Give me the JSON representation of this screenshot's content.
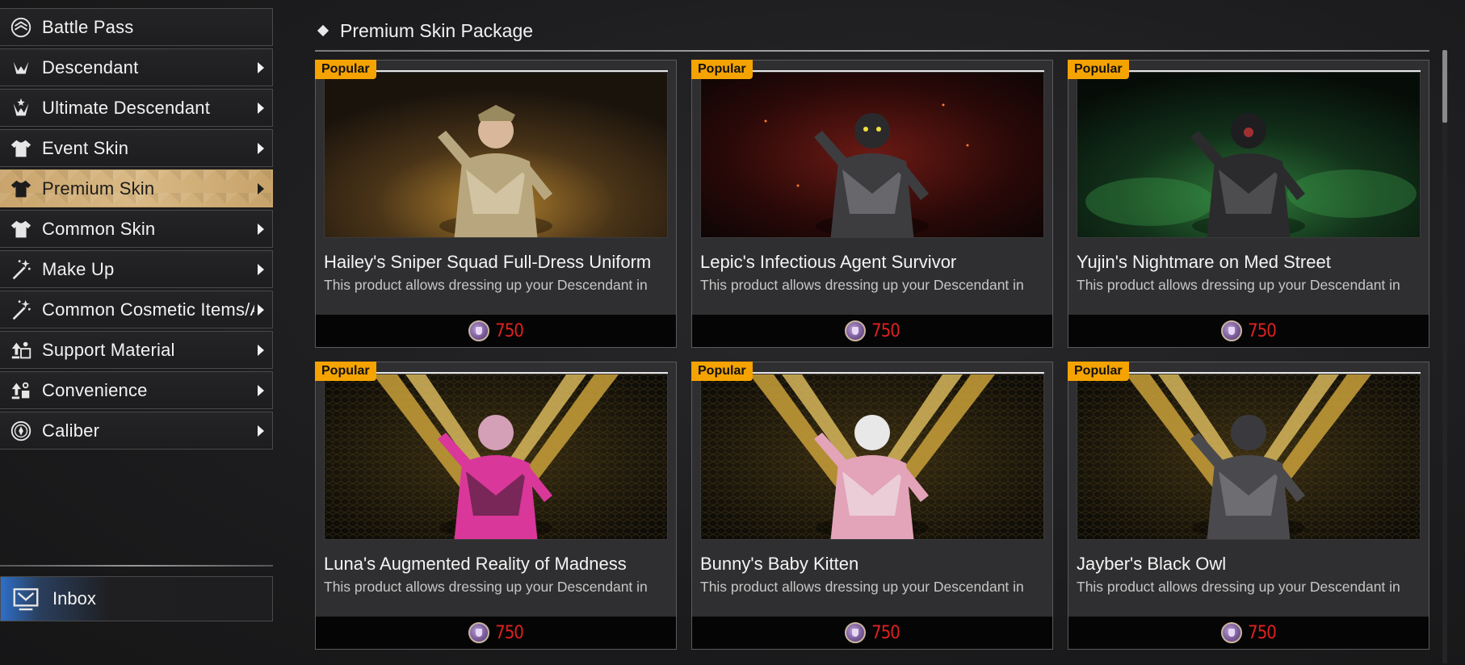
{
  "sidebar": {
    "items": [
      {
        "label": "Battle Pass",
        "icon": "battle-pass-icon",
        "has_arrow": false,
        "active": false
      },
      {
        "label": "Descendant",
        "icon": "descendant-icon",
        "has_arrow": true,
        "active": false
      },
      {
        "label": "Ultimate Descendant",
        "icon": "ultimate-descendant-icon",
        "has_arrow": true,
        "active": false
      },
      {
        "label": "Event Skin",
        "icon": "shirt-icon",
        "has_arrow": true,
        "active": false
      },
      {
        "label": "Premium Skin",
        "icon": "shirt-icon",
        "has_arrow": true,
        "active": true
      },
      {
        "label": "Common Skin",
        "icon": "shirt-icon",
        "has_arrow": true,
        "active": false
      },
      {
        "label": "Make Up",
        "icon": "magic-wand-icon",
        "has_arrow": true,
        "active": false
      },
      {
        "label": "Common Cosmetic Items/A",
        "icon": "magic-wand-icon",
        "has_arrow": true,
        "active": false
      },
      {
        "label": "Support Material",
        "icon": "support-material-icon",
        "has_arrow": true,
        "active": false
      },
      {
        "label": "Convenience",
        "icon": "convenience-icon",
        "has_arrow": true,
        "active": false
      },
      {
        "label": "Caliber",
        "icon": "caliber-icon",
        "has_arrow": true,
        "active": false
      }
    ],
    "inbox": {
      "label": "Inbox",
      "icon": "inbox-icon"
    }
  },
  "section": {
    "title": "Premium Skin Package"
  },
  "cards": [
    {
      "badge": "Popular",
      "name": "Hailey's Sniper Squad Full-Dress Uniform",
      "desc": "This product allows dressing up your Descendant in",
      "price": "750",
      "theme": "hailey"
    },
    {
      "badge": "Popular",
      "name": "Lepic's Infectious Agent Survivor",
      "desc": "This product allows dressing up your Descendant in",
      "price": "750",
      "theme": "lepic"
    },
    {
      "badge": "Popular",
      "name": "Yujin's Nightmare on Med Street",
      "desc": "This product allows dressing up your Descendant in",
      "price": "750",
      "theme": "yujin"
    },
    {
      "badge": "Popular",
      "name": "Luna's Augmented Reality of Madness",
      "desc": "This product allows dressing up your Descendant in",
      "price": "750",
      "theme": "luna"
    },
    {
      "badge": "Popular",
      "name": "Bunny's Baby Kitten",
      "desc": "This product allows dressing up your Descendant in",
      "price": "750",
      "theme": "bunny"
    },
    {
      "badge": "Popular",
      "name": "Jayber's Black Owl",
      "desc": "This product allows dressing up your Descendant in",
      "price": "750",
      "theme": "jayber"
    }
  ],
  "colors": {
    "accent_gold": "#c9a46c",
    "badge": "#f5a300",
    "price": "#e02020",
    "inbox_blue": "#2e6fc7"
  }
}
